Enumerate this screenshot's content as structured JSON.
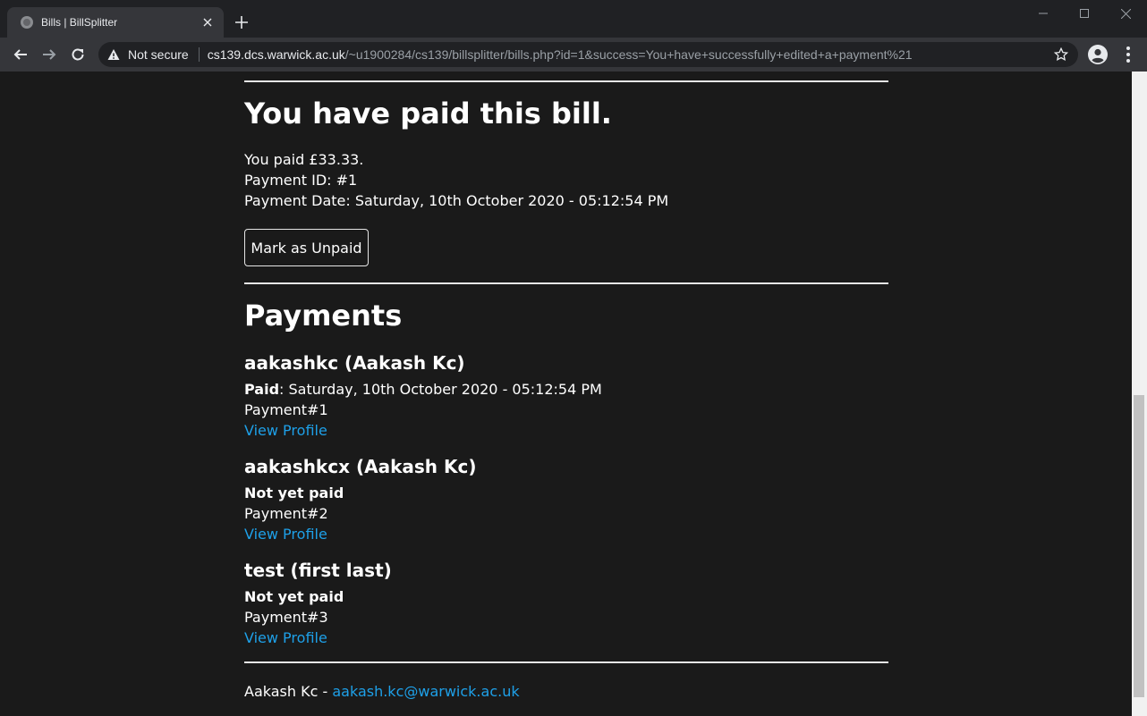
{
  "browser": {
    "tab_title": "Bills | BillSplitter",
    "security_label": "Not secure",
    "url_host": "cs139.dcs.warwick.ac.uk",
    "url_path": "/~u1900284/cs139/billsplitter/bills.php?id=1&success=You+have+successfully+edited+a+payment%21"
  },
  "paid_section": {
    "heading": "You have paid this bill.",
    "amount_line": "You paid £33.33.",
    "payment_id_line": "Payment ID: #1",
    "payment_date_line": "Payment Date: Saturday, 10th October 2020 - 05:12:54 PM",
    "unpaid_button_label": "Mark as Unpaid"
  },
  "payments_section": {
    "heading": "Payments",
    "items": [
      {
        "user": "aakashkc (Aakash Kc)",
        "status_label": "Paid",
        "status_detail": ": Saturday, 10th October 2020 - 05:12:54 PM",
        "payment_ref": "Payment#1",
        "link_label": "View Profile"
      },
      {
        "user": "aakashkcx (Aakash Kc)",
        "status_label": "Not yet paid",
        "status_detail": "",
        "payment_ref": "Payment#2",
        "link_label": "View Profile"
      },
      {
        "user": "test (first last)",
        "status_label": "Not yet paid",
        "status_detail": "",
        "payment_ref": "Payment#3",
        "link_label": "View Profile"
      }
    ]
  },
  "footer": {
    "author": "Aakash Kc - ",
    "email": "aakash.kc@warwick.ac.uk"
  },
  "colors": {
    "page_background": "#1a1a1a",
    "link": "#1ea0e8",
    "chrome_dark": "#202124",
    "chrome_toolbar": "#35363a"
  }
}
